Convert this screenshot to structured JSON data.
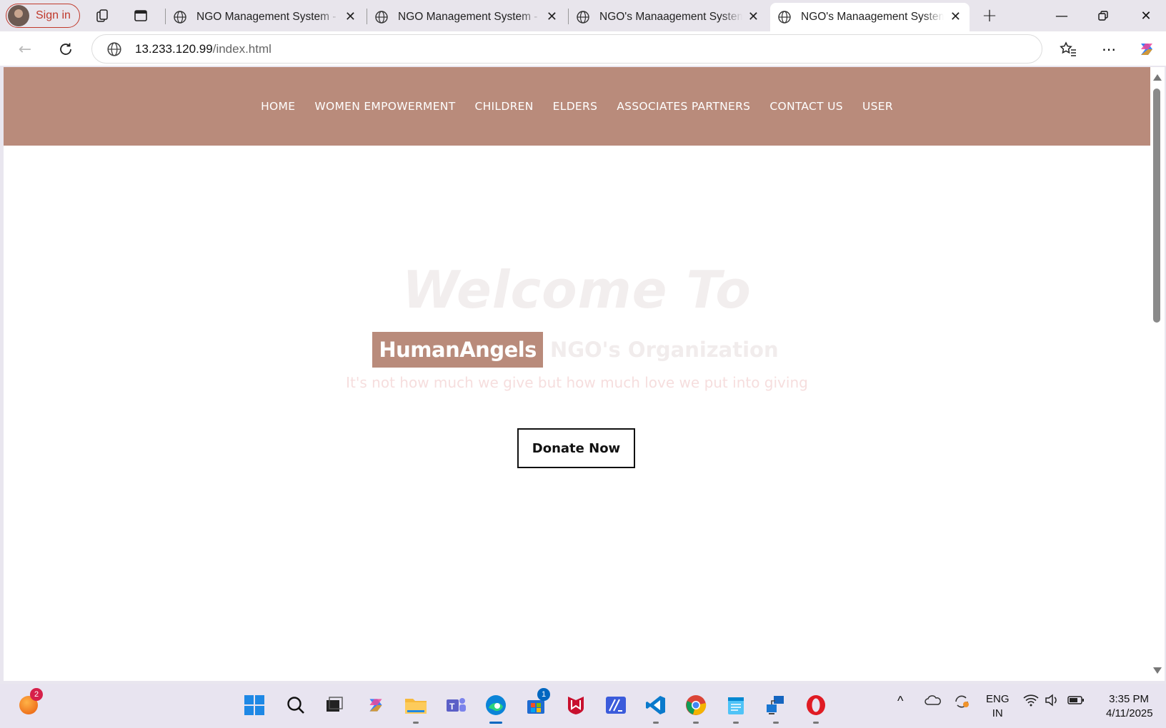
{
  "browser": {
    "signin_label": "Sign in",
    "tabs": [
      {
        "title": "NGO Management System - Admin"
      },
      {
        "title": "NGO Management System - View"
      },
      {
        "title": "NGO's Manaagement System"
      },
      {
        "title": "NGO's Manaagement System"
      }
    ],
    "url_host": "13.233.120.99",
    "url_path": "/index.html"
  },
  "site": {
    "nav": [
      "HOME",
      "WOMEN EMPOWERMENT",
      "CHILDREN",
      "ELDERS",
      "ASSOCIATES PARTNERS",
      "CONTACT US",
      "USER"
    ],
    "hero_title": "Welcome To",
    "brand": "HumanAngels",
    "org_text": "NGO's Organization",
    "tagline": "It's not how much we give but how much love we put into giving",
    "donate_label": "Donate Now",
    "accent_color": "#b98b7b"
  },
  "taskbar": {
    "notification_count": "2",
    "store_badge": "1",
    "lang_line1": "ENG",
    "lang_line2": "IN",
    "time": "3:35 PM",
    "date": "4/11/2025"
  }
}
